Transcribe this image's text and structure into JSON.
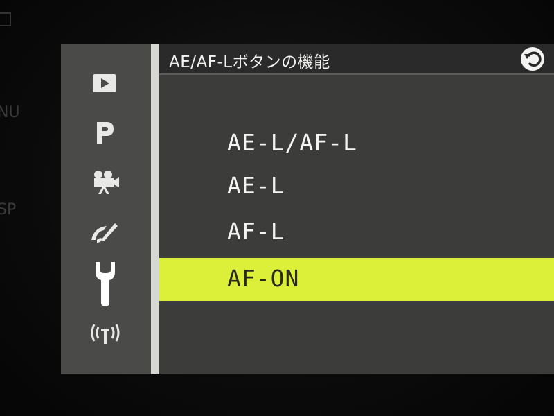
{
  "bezel": {
    "menu_label": "NU",
    "disp_label": "SP"
  },
  "header": {
    "title": "AE/AF-Lボタンの機能",
    "back_icon": "back-arrow-icon"
  },
  "sidebar": {
    "items": [
      {
        "icon": "playback-icon"
      },
      {
        "icon": "shooting-mode-p-icon"
      },
      {
        "icon": "movie-camera-icon"
      },
      {
        "icon": "custom-setting-brush-icon"
      },
      {
        "icon": "wrench-setup-icon",
        "active": true
      },
      {
        "icon": "wireless-icon"
      }
    ]
  },
  "options": [
    {
      "label": "AE-L/AF-L",
      "selected": false
    },
    {
      "label": "AE-L",
      "selected": false
    },
    {
      "label": "AF-L",
      "selected": false
    },
    {
      "label": "AF-ON",
      "selected": true
    }
  ],
  "colors": {
    "highlight": "#dcf03a",
    "background": "#3c3c3a",
    "sidebar": "#4a4a48",
    "text": "#f4f4f2"
  }
}
